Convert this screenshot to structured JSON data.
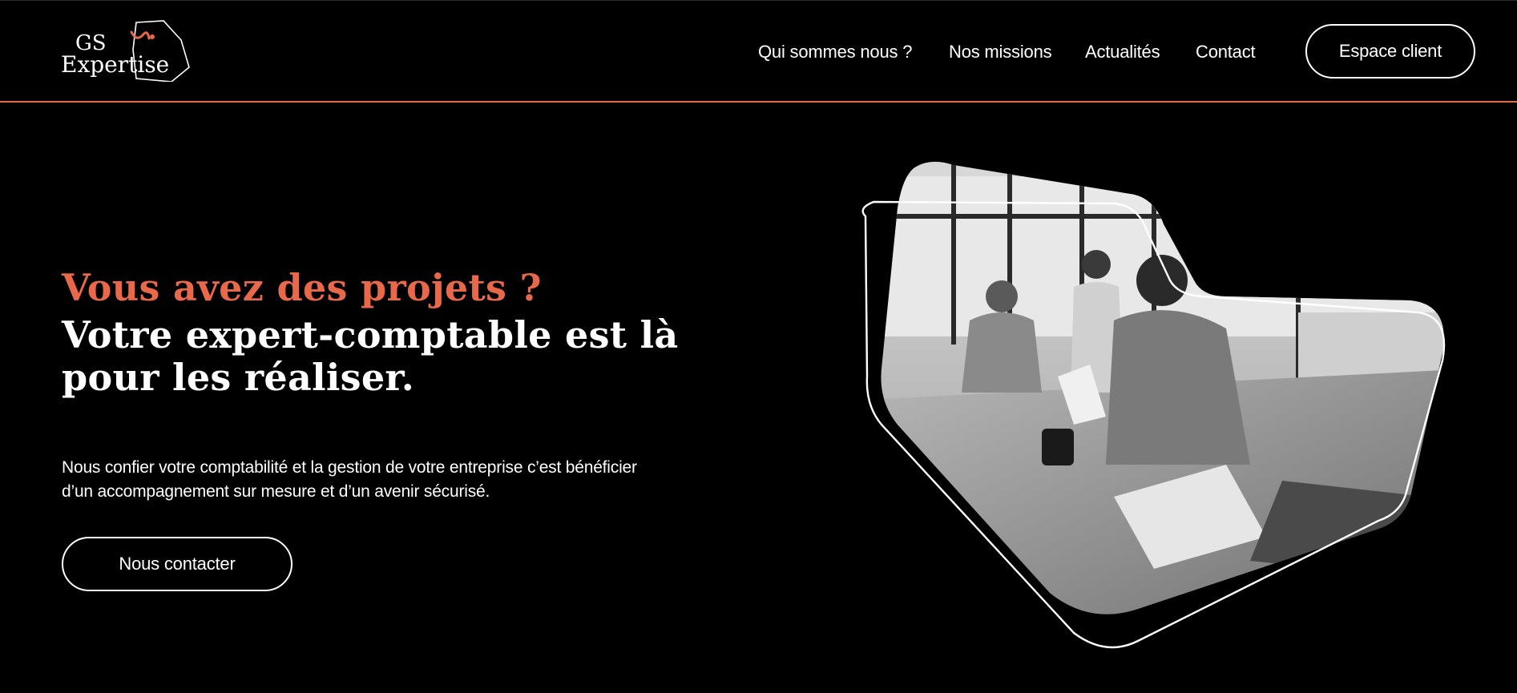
{
  "header": {
    "logo": {
      "line1": "GS",
      "line2": "Expertise",
      "accent": "#e8684a"
    },
    "nav": [
      {
        "label": "Qui sommes nous ?"
      },
      {
        "label": "Nos missions"
      },
      {
        "label": "Actualités"
      },
      {
        "label": "Contact"
      }
    ],
    "espace_client_label": "Espace client",
    "divider_color": "#e8684a"
  },
  "hero": {
    "headline_accent": "Vous avez des projets ?",
    "headline_main": "Votre expert-comptable est là pour les réaliser.",
    "description": "Nous confier votre comptabilité et la gestion de votre entreprise c’est bénéficier d’un accompagnement sur mesure et d’un avenir sécurisé.",
    "cta_label": "Nous contacter",
    "image": {
      "subject": "black-and-white office meeting photo",
      "frame_icon": "outlined-polygon-frame"
    }
  },
  "colors": {
    "background": "#000000",
    "text": "#ffffff",
    "accent": "#e8684a"
  }
}
